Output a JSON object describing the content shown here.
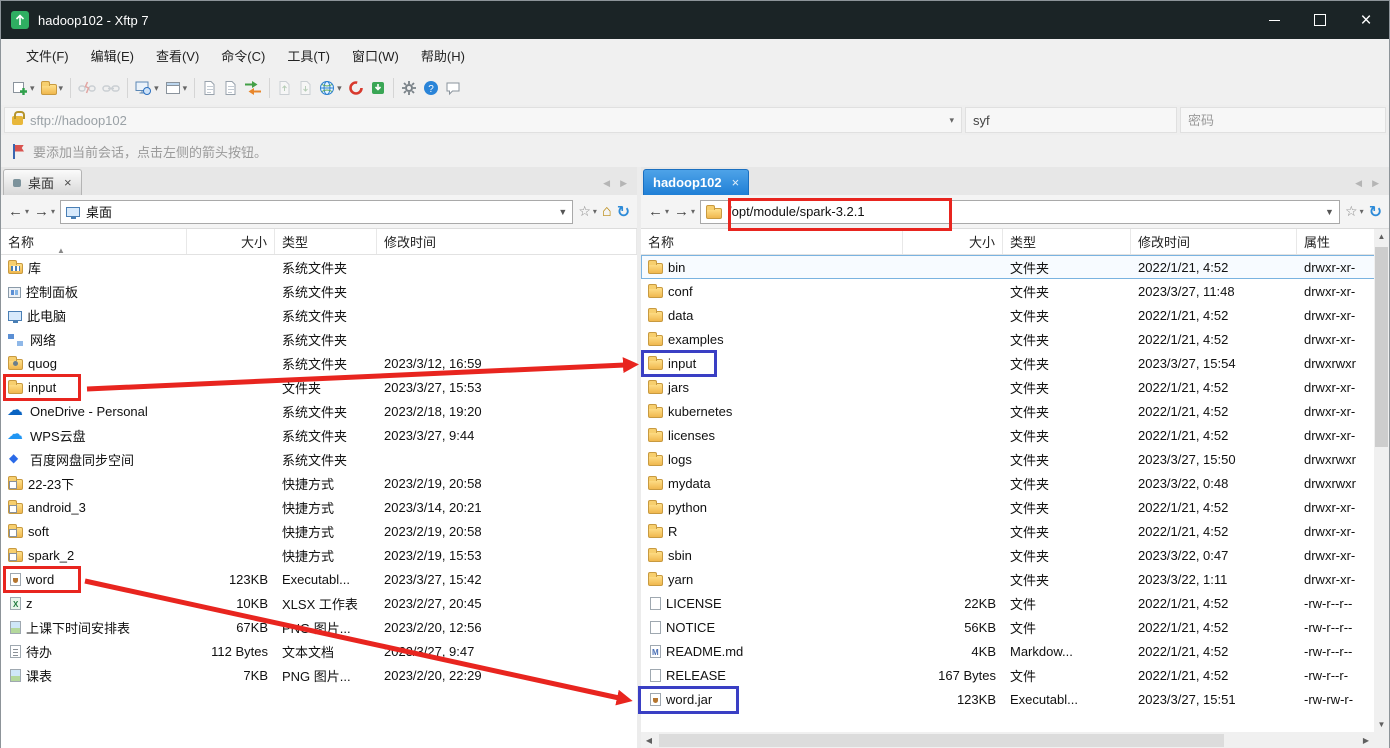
{
  "window": {
    "title": "hadoop102 - Xftp 7"
  },
  "menu": {
    "items": [
      "文件(F)",
      "编辑(E)",
      "查看(V)",
      "命令(C)",
      "工具(T)",
      "窗口(W)",
      "帮助(H)"
    ]
  },
  "toolbar": {
    "icons": [
      "new-session-icon",
      "open-folder-icon",
      "disconnect-icon",
      "reconnect-link-icon",
      "views-monitor-icon",
      "layout-window-icon",
      "copy-doc-icon",
      "paste-doc-icon",
      "transfer-arrows-icon",
      "upload-doc-icon",
      "download-doc-icon",
      "web-globe-icon",
      "swirl-icon",
      "download-manager-icon",
      "settings-gear-icon",
      "help-icon",
      "feedback-chat-icon"
    ]
  },
  "address": {
    "url": "sftp://hadoop102",
    "username": "syf",
    "password_placeholder": "密码"
  },
  "infobar": {
    "text": "要添加当前会话，点击左侧的箭头按钮。"
  },
  "left_pane": {
    "tab": "桌面",
    "path": "桌面",
    "columns": [
      "名称",
      "大小",
      "类型",
      "修改时间"
    ],
    "rows": [
      {
        "name": "库",
        "size": "",
        "type": "系统文件夹",
        "time": "",
        "icon": "library"
      },
      {
        "name": "控制面板",
        "size": "",
        "type": "系统文件夹",
        "time": "",
        "icon": "control"
      },
      {
        "name": "此电脑",
        "size": "",
        "type": "系统文件夹",
        "time": "",
        "icon": "computer"
      },
      {
        "name": "网络",
        "size": "",
        "type": "系统文件夹",
        "time": "",
        "icon": "network"
      },
      {
        "name": "quog",
        "size": "",
        "type": "系统文件夹",
        "time": "2023/3/12, 16:59",
        "icon": "user"
      },
      {
        "name": "input",
        "size": "",
        "type": "文件夹",
        "time": "2023/3/27, 15:53",
        "icon": "folder"
      },
      {
        "name": "OneDrive - Personal",
        "size": "",
        "type": "系统文件夹",
        "time": "2023/2/18, 19:20",
        "icon": "onedrive"
      },
      {
        "name": "WPS云盘",
        "size": "",
        "type": "系统文件夹",
        "time": "2023/3/27, 9:44",
        "icon": "wps"
      },
      {
        "name": "百度网盘同步空间",
        "size": "",
        "type": "系统文件夹",
        "time": "",
        "icon": "baidu"
      },
      {
        "name": "22-23下",
        "size": "",
        "type": "快捷方式",
        "time": "2023/2/19, 20:58",
        "icon": "shortcut"
      },
      {
        "name": "android_3",
        "size": "",
        "type": "快捷方式",
        "time": "2023/3/14, 20:21",
        "icon": "shortcut"
      },
      {
        "name": "soft",
        "size": "",
        "type": "快捷方式",
        "time": "2023/2/19, 20:58",
        "icon": "shortcut"
      },
      {
        "name": "spark_2",
        "size": "",
        "type": "快捷方式",
        "time": "2023/2/19, 15:53",
        "icon": "shortcut"
      },
      {
        "name": "word",
        "size": "123KB",
        "type": "Executabl...",
        "time": "2023/3/27, 15:42",
        "icon": "jar"
      },
      {
        "name": "z",
        "size": "10KB",
        "type": "XLSX 工作表",
        "time": "2023/2/27, 20:45",
        "icon": "excel"
      },
      {
        "name": "上课下时间安排表",
        "size": "67KB",
        "type": "PNG 图片...",
        "time": "2023/2/20, 12:56",
        "icon": "image"
      },
      {
        "name": "待办",
        "size": "112 Bytes",
        "type": "文本文档",
        "time": "2023/3/27, 9:47",
        "icon": "text"
      },
      {
        "name": "课表",
        "size": "7KB",
        "type": "PNG 图片...",
        "time": "2023/2/20, 22:29",
        "icon": "image"
      }
    ]
  },
  "right_pane": {
    "tab": "hadoop102",
    "path": "/opt/module/spark-3.2.1",
    "columns": [
      "名称",
      "大小",
      "类型",
      "修改时间",
      "属性"
    ],
    "rows": [
      {
        "name": "bin",
        "size": "",
        "type": "文件夹",
        "time": "2022/1/21, 4:52",
        "attr": "drwxr-xr-",
        "icon": "folder",
        "selected": true
      },
      {
        "name": "conf",
        "size": "",
        "type": "文件夹",
        "time": "2023/3/27, 11:48",
        "attr": "drwxr-xr-",
        "icon": "folder"
      },
      {
        "name": "data",
        "size": "",
        "type": "文件夹",
        "time": "2022/1/21, 4:52",
        "attr": "drwxr-xr-",
        "icon": "folder"
      },
      {
        "name": "examples",
        "size": "",
        "type": "文件夹",
        "time": "2022/1/21, 4:52",
        "attr": "drwxr-xr-",
        "icon": "folder"
      },
      {
        "name": "input",
        "size": "",
        "type": "文件夹",
        "time": "2023/3/27, 15:54",
        "attr": "drwxrwxr",
        "icon": "folder"
      },
      {
        "name": "jars",
        "size": "",
        "type": "文件夹",
        "time": "2022/1/21, 4:52",
        "attr": "drwxr-xr-",
        "icon": "folder"
      },
      {
        "name": "kubernetes",
        "size": "",
        "type": "文件夹",
        "time": "2022/1/21, 4:52",
        "attr": "drwxr-xr-",
        "icon": "folder"
      },
      {
        "name": "licenses",
        "size": "",
        "type": "文件夹",
        "time": "2022/1/21, 4:52",
        "attr": "drwxr-xr-",
        "icon": "folder"
      },
      {
        "name": "logs",
        "size": "",
        "type": "文件夹",
        "time": "2023/3/27, 15:50",
        "attr": "drwxrwxr",
        "icon": "folder"
      },
      {
        "name": "mydata",
        "size": "",
        "type": "文件夹",
        "time": "2023/3/22, 0:48",
        "attr": "drwxrwxr",
        "icon": "folder"
      },
      {
        "name": "python",
        "size": "",
        "type": "文件夹",
        "time": "2022/1/21, 4:52",
        "attr": "drwxr-xr-",
        "icon": "folder"
      },
      {
        "name": "R",
        "size": "",
        "type": "文件夹",
        "time": "2022/1/21, 4:52",
        "attr": "drwxr-xr-",
        "icon": "folder"
      },
      {
        "name": "sbin",
        "size": "",
        "type": "文件夹",
        "time": "2023/3/22, 0:47",
        "attr": "drwxr-xr-",
        "icon": "folder"
      },
      {
        "name": "yarn",
        "size": "",
        "type": "文件夹",
        "time": "2023/3/22, 1:11",
        "attr": "drwxr-xr-",
        "icon": "folder"
      },
      {
        "name": "LICENSE",
        "size": "22KB",
        "type": "文件",
        "time": "2022/1/21, 4:52",
        "attr": "-rw-r--r--",
        "icon": "file"
      },
      {
        "name": "NOTICE",
        "size": "56KB",
        "type": "文件",
        "time": "2022/1/21, 4:52",
        "attr": "-rw-r--r--",
        "icon": "file"
      },
      {
        "name": "README.md",
        "size": "4KB",
        "type": "Markdow...",
        "time": "2022/1/21, 4:52",
        "attr": "-rw-r--r--",
        "icon": "markdown"
      },
      {
        "name": "RELEASE",
        "size": "167 Bytes",
        "type": "文件",
        "time": "2022/1/21, 4:52",
        "attr": "-rw-r--r-",
        "icon": "file"
      },
      {
        "name": "word.jar",
        "size": "123KB",
        "type": "Executabl...",
        "time": "2023/3/27, 15:51",
        "attr": "-rw-rw-r-",
        "icon": "jar"
      }
    ]
  },
  "annotations": {
    "red_highlight_color": "#e8251f",
    "blue_highlight_color": "#3a3fc4"
  }
}
